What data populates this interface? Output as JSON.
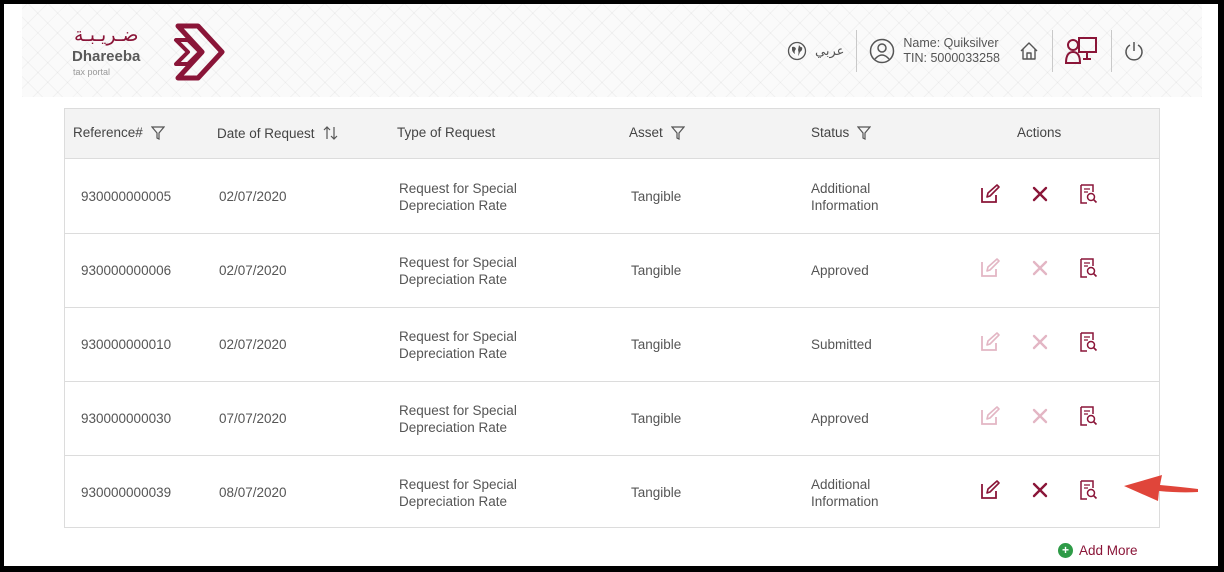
{
  "header": {
    "logo_ar": "ضـريـبـة",
    "logo_en": "Dhareeba",
    "logo_sub": "tax portal",
    "language_label": "عربي",
    "user_name": "Name: Quiksilver",
    "user_tin": "TIN: 5000033258",
    "icons": [
      "globe-icon",
      "user-icon",
      "home-icon",
      "dashboard-icon",
      "power-icon"
    ]
  },
  "table": {
    "columns": {
      "reference": "Reference#",
      "date": "Date of Request",
      "type": "Type of Request",
      "asset": "Asset",
      "status": "Status",
      "actions": "Actions"
    },
    "rows": [
      {
        "ref": "930000000005",
        "date": "02/07/2020",
        "type_line1": "Request for Special",
        "type_line2": "Depreciation Rate",
        "asset": "Tangible",
        "status_line1": "Additional",
        "status_line2": "Information",
        "status": "",
        "editable": true
      },
      {
        "ref": "930000000006",
        "date": "02/07/2020",
        "type_line1": "Request for Special",
        "type_line2": "Depreciation Rate",
        "asset": "Tangible",
        "status_line1": "",
        "status_line2": "",
        "status": "Approved",
        "editable": false
      },
      {
        "ref": "930000000010",
        "date": "02/07/2020",
        "type_line1": "Request for Special",
        "type_line2": "Depreciation Rate",
        "asset": "Tangible",
        "status_line1": "",
        "status_line2": "",
        "status": "Submitted",
        "editable": false
      },
      {
        "ref": "930000000030",
        "date": "07/07/2020",
        "type_line1": "Request for Special",
        "type_line2": "Depreciation Rate",
        "asset": "Tangible",
        "status_line1": "",
        "status_line2": "",
        "status": "Approved",
        "editable": false
      },
      {
        "ref": "930000000039",
        "date": "08/07/2020",
        "type_line1": "Request for Special",
        "type_line2": "Depreciation Rate",
        "asset": "Tangible",
        "status_line1": "Additional",
        "status_line2": "Information",
        "status": "",
        "editable": true
      }
    ]
  },
  "add_more_label": "Add More",
  "colors": {
    "brand": "#8a1538",
    "brand_faded": "#e3b6c4",
    "add_green": "#2e9b47",
    "arrow": "#e0453a"
  }
}
